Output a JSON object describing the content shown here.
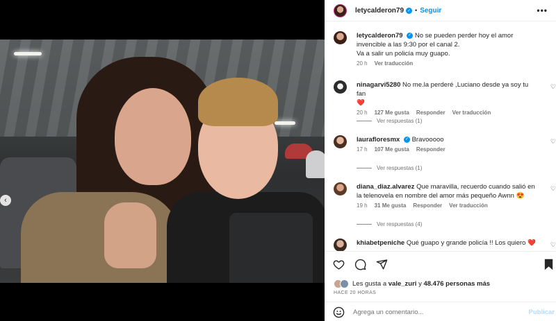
{
  "post": {
    "username": "letycalderon79",
    "follow_label": "Seguir",
    "more_label": "•••",
    "separator": "•",
    "caption_line1": "No se pueden perder hoy el amor invencible a las 9:30 por el canal 2.",
    "caption_line2": "Va a salir un policía muy guapo.",
    "caption_time": "20 h",
    "see_translation": "Ver traducción"
  },
  "media": {
    "prev_icon": "chevron-left-icon",
    "slides_total": 3,
    "slide_active": 3
  },
  "comments": [
    {
      "username": "ninagarvi5280",
      "text": "No me.la perderé ,Luciano desde ya soy tu fan",
      "emoji": "❤️",
      "time": "20 h",
      "likes": "127 Me gusta",
      "reply": "Responder",
      "translate": "Ver traducción",
      "replies": "Ver respuestas (1)"
    },
    {
      "username": "laurafloresmx",
      "text": "Bravooooo",
      "time": "17 h",
      "likes": "107 Me gusta",
      "reply": "Responder",
      "replies": "Ver respuestas (1)"
    },
    {
      "username": "diana_diaz.alvarez",
      "text": "Que maravilla, recuerdo cuando salió en la telenovela en nombre del amor más pequeño Awnn",
      "emoji": "😍",
      "time": "19 h",
      "likes": "31 Me gusta",
      "reply": "Responder",
      "translate": "Ver traducción",
      "replies": "Ver respuestas (4)"
    },
    {
      "username": "khiabetpeniche",
      "text": "Qué guapo y grande policía !! Los quiero",
      "emoji": "❤️"
    }
  ],
  "actions": {
    "liked_by_prefix": "Les gusta a",
    "liked_by_user": "vale_zuri",
    "liked_by_join": "y",
    "liked_by_rest": "48.476 personas más",
    "time_ago": "HACE 20 HORAS",
    "comment_placeholder": "Agrega un comentario...",
    "publish_label": "Publicar"
  },
  "colors": {
    "accent": "#0095f6",
    "heart": "#ed4956",
    "muted": "#737373"
  }
}
